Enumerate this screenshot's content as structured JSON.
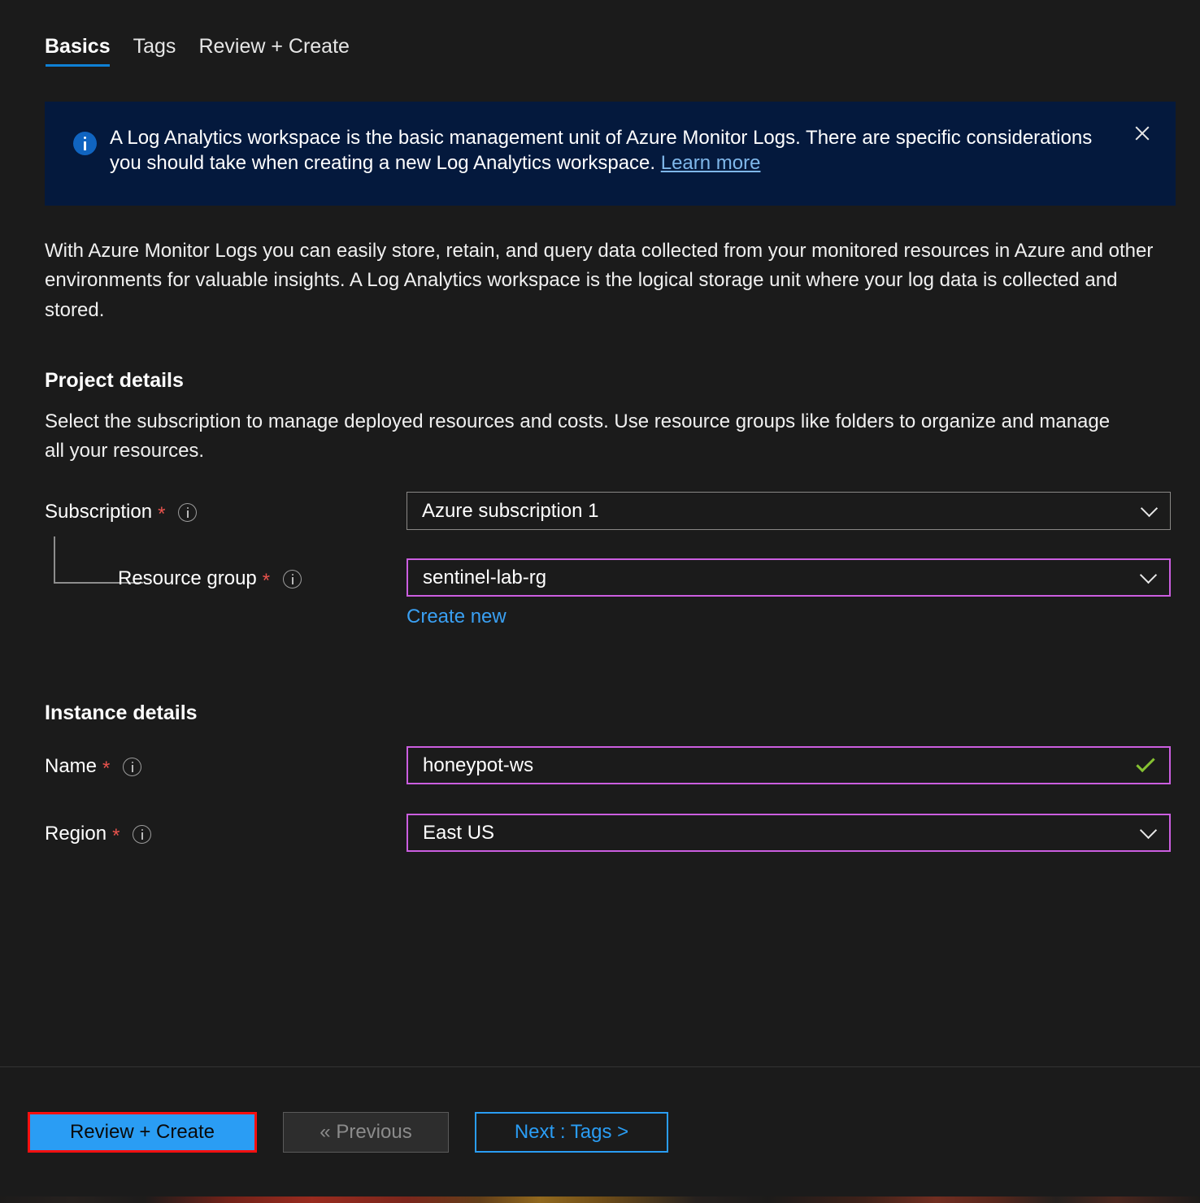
{
  "tabs": [
    {
      "label": "Basics",
      "active": true
    },
    {
      "label": "Tags",
      "active": false
    },
    {
      "label": "Review + Create",
      "active": false
    }
  ],
  "banner": {
    "text": "A Log Analytics workspace is the basic management unit of Azure Monitor Logs. There are specific considerations you should take when creating a new Log Analytics workspace. ",
    "link_label": "Learn more",
    "close_label": "Close",
    "background": "#04193d",
    "icon": "info-icon"
  },
  "intro": "With Azure Monitor Logs you can easily store, retain, and query data collected from your monitored resources in Azure and other environments for valuable insights. A Log Analytics workspace is the logical storage unit where your log data is collected and stored.",
  "project_details": {
    "heading": "Project details",
    "description": "Select the subscription to manage deployed resources and costs. Use resource groups like folders to organize and manage all your resources.",
    "subscription": {
      "label": "Subscription",
      "required_mark": "*",
      "value": "Azure subscription 1",
      "border_color": "#8a8886"
    },
    "resource_group": {
      "label": "Resource group",
      "required_mark": "*",
      "value": "sentinel-lab-rg",
      "create_new_label": "Create new",
      "border_color": "#cb5ee0"
    }
  },
  "instance_details": {
    "heading": "Instance details",
    "name": {
      "label": "Name",
      "required_mark": "*",
      "value": "honeypot-ws",
      "validation": "valid-checkmark",
      "border_color": "#cb5ee0",
      "check_color": "#86c232"
    },
    "region": {
      "label": "Region",
      "required_mark": "*",
      "value": "East US",
      "border_color": "#cb5ee0"
    }
  },
  "footer": {
    "review_create_label": "Review + Create",
    "previous_label": "« Previous",
    "next_label": "Next : Tags >",
    "primary_color": "#2a9df4",
    "highlight_color": "#fa0f0f"
  }
}
